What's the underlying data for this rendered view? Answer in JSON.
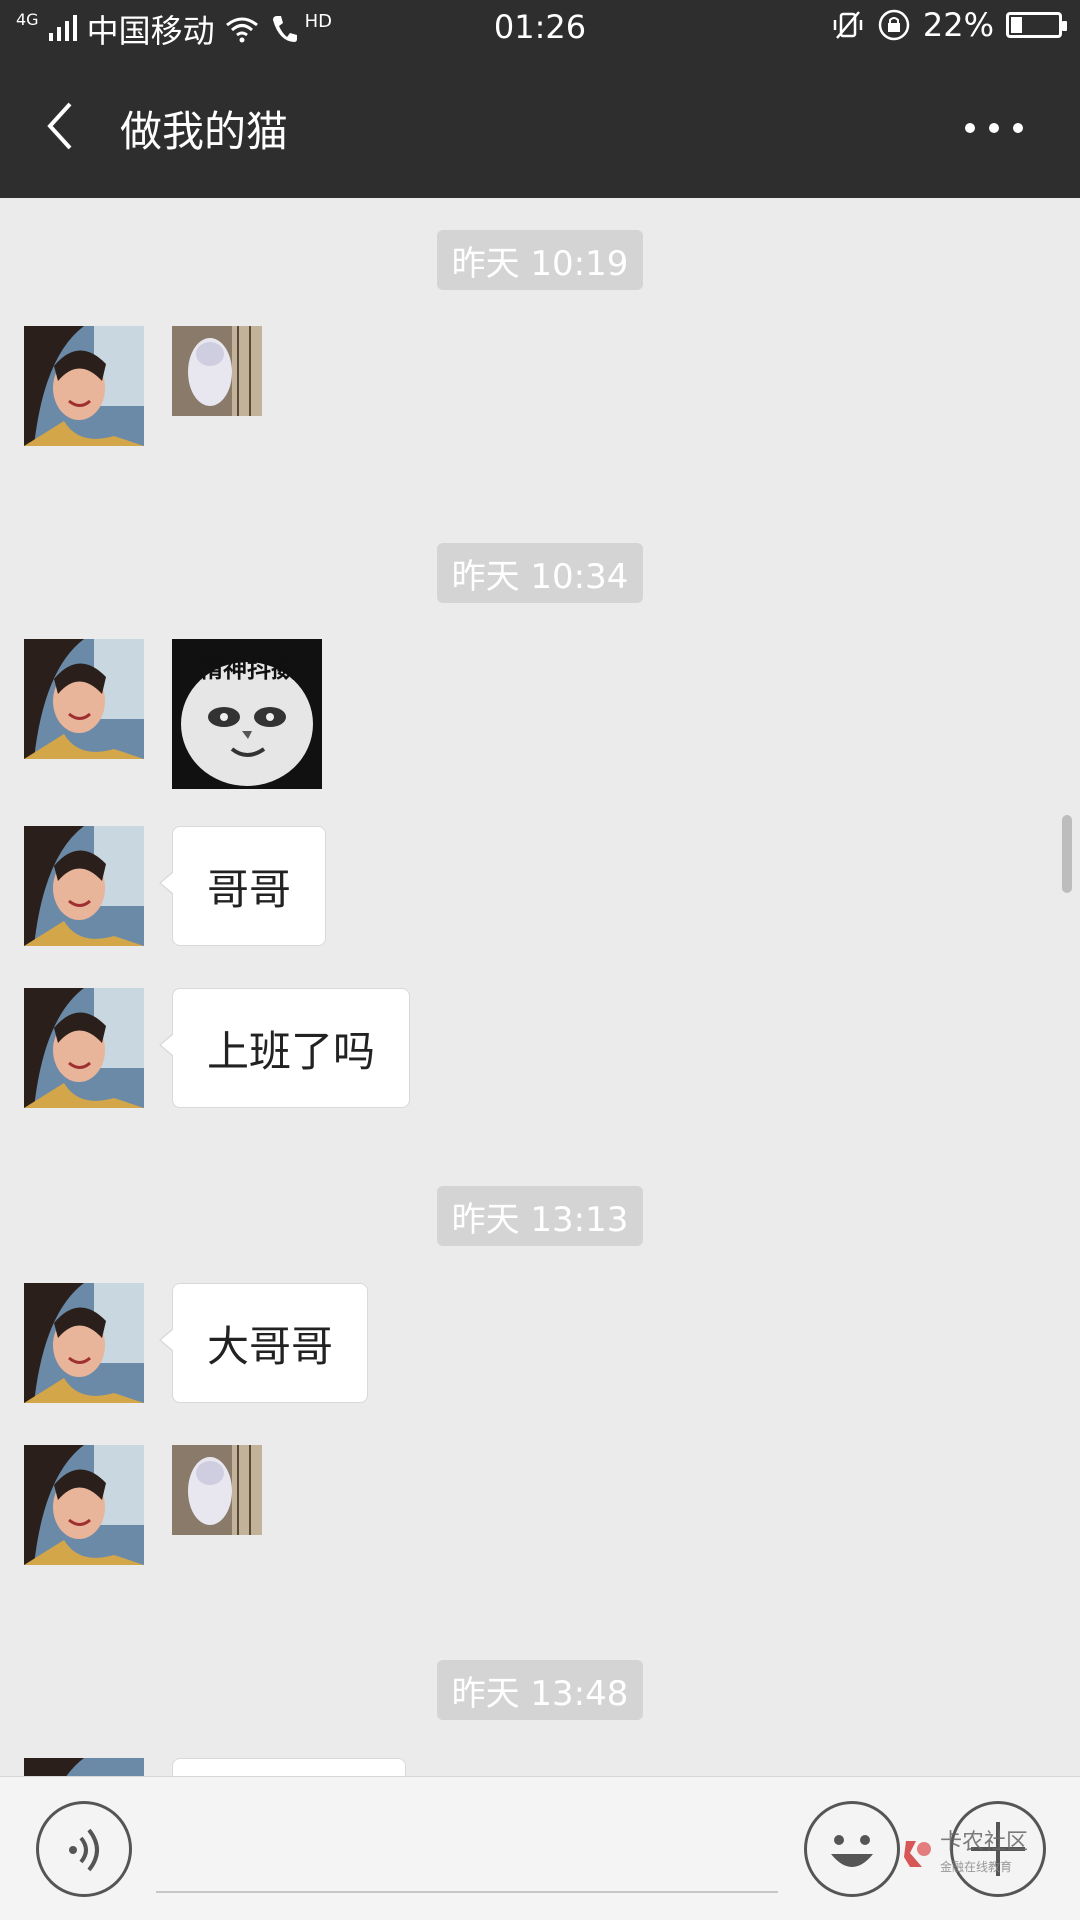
{
  "status_bar": {
    "network": "4G",
    "carrier": "中国移动",
    "hd": "HD",
    "time": "01:26",
    "battery": "22%",
    "battery_level": 0.22
  },
  "nav": {
    "title": "做我的猫"
  },
  "messages": {
    "ts1": "昨天 10:19",
    "ts2": "昨天 10:34",
    "sticker_text": "精神抖擞",
    "text1": "哥哥",
    "text2": "上班了吗",
    "ts3": "昨天 13:13",
    "text3": "大哥哥",
    "ts4": "昨天 13:48"
  },
  "input": {
    "placeholder": ""
  },
  "watermark": {
    "title": "卡农社区",
    "subtitle": "金融在线教育"
  },
  "colors": {
    "header": "#2e2e2e",
    "chat_bg": "#ebebeb",
    "timestamp_bg": "#d4d4d4",
    "bubble": "#ffffff"
  }
}
